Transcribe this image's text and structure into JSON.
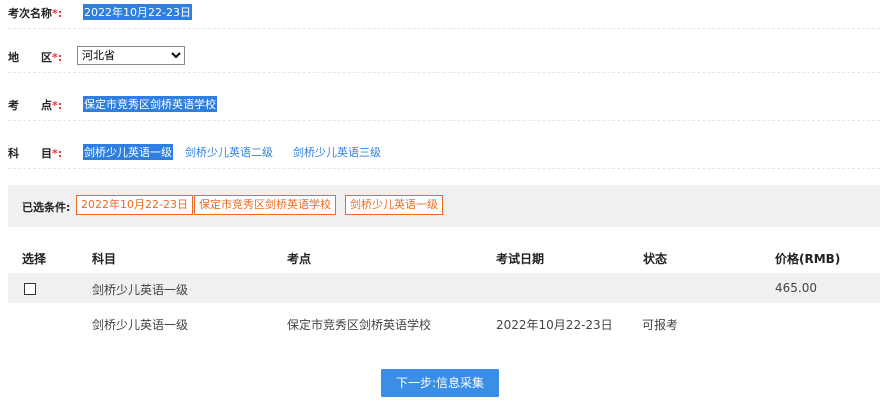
{
  "form": {
    "exam_name": {
      "label": "考次名称",
      "required_mark": "*:",
      "value": "2022年10月22-23日"
    },
    "region": {
      "label": "地　　区",
      "required_mark": "*:",
      "selected": "河北省"
    },
    "site": {
      "label": "考　　点",
      "required_mark": "*:",
      "value": "保定市竞秀区剑桥英语学校"
    },
    "subject": {
      "label": "科　　目",
      "required_mark": "*:",
      "options": [
        "剑桥少儿英语一级",
        "剑桥少儿英语二级",
        "剑桥少儿英语三级"
      ],
      "selected_index": 0
    }
  },
  "filter": {
    "label": "已选条件:",
    "tags": [
      "2022年10月22-23日",
      "保定市竞秀区剑桥英语学校",
      "剑桥少儿英语一级"
    ]
  },
  "table": {
    "headers": [
      "选择",
      "科目",
      "考点",
      "考试日期",
      "状态",
      "价格(RMB)"
    ],
    "group_row": {
      "subject": "剑桥少儿英语一级",
      "price": "465.00"
    },
    "detail_row": {
      "subject": "剑桥少儿英语一级",
      "site": "保定市竞秀区剑桥英语学校",
      "date": "2022年10月22-23日",
      "status": "可报考"
    }
  },
  "next_button": "下一步:信息采集",
  "colors": {
    "accent": "#2f7fe0",
    "tag": "#ee6a21",
    "button": "#3a8ee6"
  }
}
